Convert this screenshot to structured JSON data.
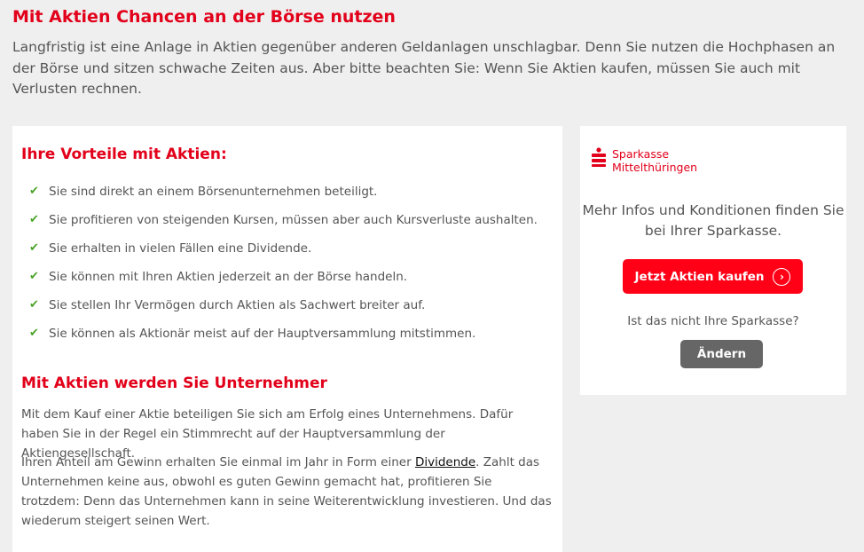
{
  "hero": {
    "title": "Mit Aktien Chancen an der Börse nutzen",
    "intro": "Langfristig ist eine Anlage in Aktien gegenüber anderen Geldanlagen unschlagbar. Denn Sie nutzen die Hochphasen an der Börse und sitzen schwache Zeiten aus. Aber bitte beachten Sie: Wenn Sie Aktien kaufen, müssen Sie auch mit Verlusten rechnen."
  },
  "benefits": {
    "heading": "Ihre Vorteile mit Aktien:",
    "items": [
      "Sie sind direkt an einem Börsenunternehmen beteiligt.",
      "Sie profitieren von steigenden Kursen, müssen aber auch Kursverluste aushalten.",
      "Sie erhalten in vielen Fällen eine Dividende.",
      "Sie können mit Ihren Aktien jederzeit an der Börse handeln.",
      "Sie stellen Ihr Vermögen durch Aktien als Sachwert breiter auf.",
      "Sie können als Aktionär meist auf der Hauptversammlung mitstimmen."
    ]
  },
  "entrepreneur": {
    "heading": "Mit Aktien werden Sie Unternehmer",
    "para1": "Mit dem Kauf einer Aktie beteiligen Sie sich am Erfolg eines Unternehmens. Dafür haben Sie in der Regel ein Stimmrecht auf der Hauptversammlung der Aktiengesellschaft.",
    "para2_before": "Ihren Anteil am Gewinn erhalten Sie einmal im Jahr in Form einer ",
    "para2_link": "Dividende",
    "para2_after": ". Zahlt das Unternehmen keine aus, obwohl es guten Gewinn gemacht hat, profitieren Sie trotzdem: Denn das Unternehmen kann in seine Weiterentwicklung investieren. Und das wiederum steigert seinen Wert."
  },
  "sidebar": {
    "logo_line1": "Sparkasse",
    "logo_line2": "Mittelthüringen",
    "info": "Mehr Infos und Konditionen finden Sie bei Ihrer Sparkasse.",
    "cta_label": "Jetzt Aktien kaufen",
    "cta_icon": "chevron-right-circle-icon",
    "question": "Ist das nicht Ihre Sparkasse?",
    "change_label": "Ändern"
  },
  "colors": {
    "brand_red": "#e2001a",
    "cta_red": "#ff0017",
    "check_green": "#4aa329",
    "button_gray": "#666666",
    "page_bg": "#efefef"
  }
}
